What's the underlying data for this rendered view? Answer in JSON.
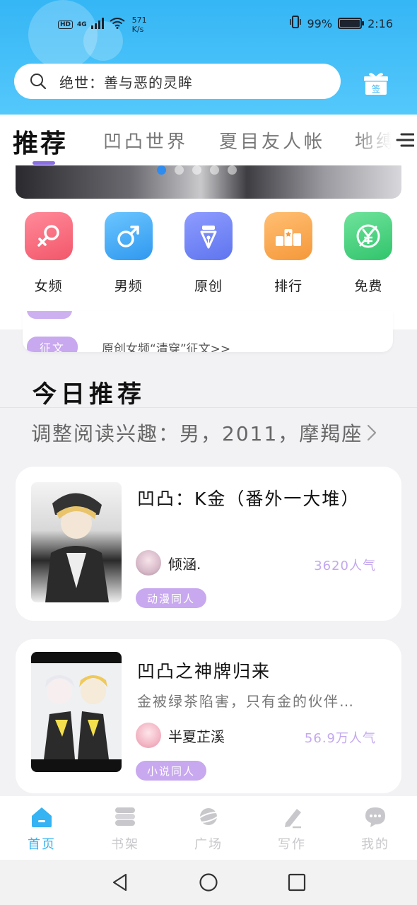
{
  "status_bar": {
    "hd": "HD",
    "network": "4G",
    "speed_value": "571",
    "speed_unit": "K/s",
    "battery": "99%",
    "battery_level": 0.99,
    "time": "2:16"
  },
  "search": {
    "text": "绝世：善与恶的灵眸"
  },
  "gift_label": "签",
  "tabs": [
    {
      "label": "推荐",
      "active": true
    },
    {
      "label": "凹凸世界"
    },
    {
      "label": "夏目友人帐"
    },
    {
      "label": "地缚"
    }
  ],
  "banner": {
    "active_dot": 0,
    "dot_count": 5
  },
  "categories": [
    {
      "label": "女频",
      "icon": "female-icon",
      "color": "#f46c7e"
    },
    {
      "label": "男频",
      "icon": "male-icon",
      "color": "#3aa6f2"
    },
    {
      "label": "原创",
      "icon": "pen-nib-icon",
      "color": "#6f86f2"
    },
    {
      "label": "排行",
      "icon": "ranking-icon",
      "color": "#f7a247"
    },
    {
      "label": "免费",
      "icon": "yen-icon",
      "color": "#3ccb77"
    }
  ],
  "notices": [
    {
      "tag": "征文",
      "text": "原创女频“清穿”征文>>"
    }
  ],
  "today": {
    "title": "今日推荐",
    "interest": "调整阅读兴趣：男，2011，摩羯座"
  },
  "books": [
    {
      "title": "凹凸：K金（番外一大堆）",
      "description": "",
      "author": "倾涵.",
      "popularity": "3620人气",
      "tag": "动漫同人"
    },
    {
      "title": "凹凸之神牌归来",
      "description": "金被绿茶陷害，只有金的伙伴…",
      "author": "半夏芷溪",
      "popularity": "56.9万人气",
      "tag": "小说同人"
    }
  ],
  "bottom_nav": [
    {
      "label": "首页",
      "icon": "home-icon",
      "active": true
    },
    {
      "label": "书架",
      "icon": "bookshelf-icon"
    },
    {
      "label": "广场",
      "icon": "planet-icon"
    },
    {
      "label": "写作",
      "icon": "pencil-icon"
    },
    {
      "label": "我的",
      "icon": "chat-bubble-icon"
    }
  ],
  "colors": {
    "header": "#35b6f5",
    "accent_purple": "#c8a8ef",
    "nav_active": "#35b3f2"
  }
}
